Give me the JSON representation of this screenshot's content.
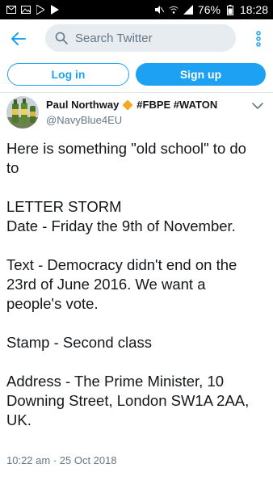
{
  "status_bar": {
    "battery_percent": "76%",
    "time": "18:28",
    "left_icons": [
      "mail-icon",
      "image-icon",
      "play-store-icon",
      "play-icon"
    ],
    "right_icons": [
      "mute-icon",
      "wifi-icon",
      "signal-icon",
      "battery-icon"
    ]
  },
  "header": {
    "search_placeholder": "Search Twitter"
  },
  "auth": {
    "login_label": "Log in",
    "signup_label": "Sign up"
  },
  "tweet": {
    "display_name": "Paul Northway",
    "name_badge_icon": "orange-diamond-icon",
    "hashtags": "#FBPE #WATON",
    "handle": "@NavyBlue4EU",
    "lines": [
      "Here is something \"old school\" to do",
      "to",
      "",
      "LETTER STORM",
      "Date - Friday the 9th of November.",
      "",
      "Text - Democracy didn't end on the",
      "23rd of June 2016. We want a",
      "people's vote.",
      "",
      "Stamp - Second class",
      "",
      "Address - The Prime Minister, 10",
      "Downing Street, London SW1A 2AA,",
      "UK."
    ],
    "timestamp": "10:22 am · 25 Oct 2018"
  },
  "colors": {
    "brand_blue": "#1da1f2",
    "search_bg": "#e6ecf0",
    "muted_text": "#657786",
    "status_bar_bg": "#000000"
  }
}
